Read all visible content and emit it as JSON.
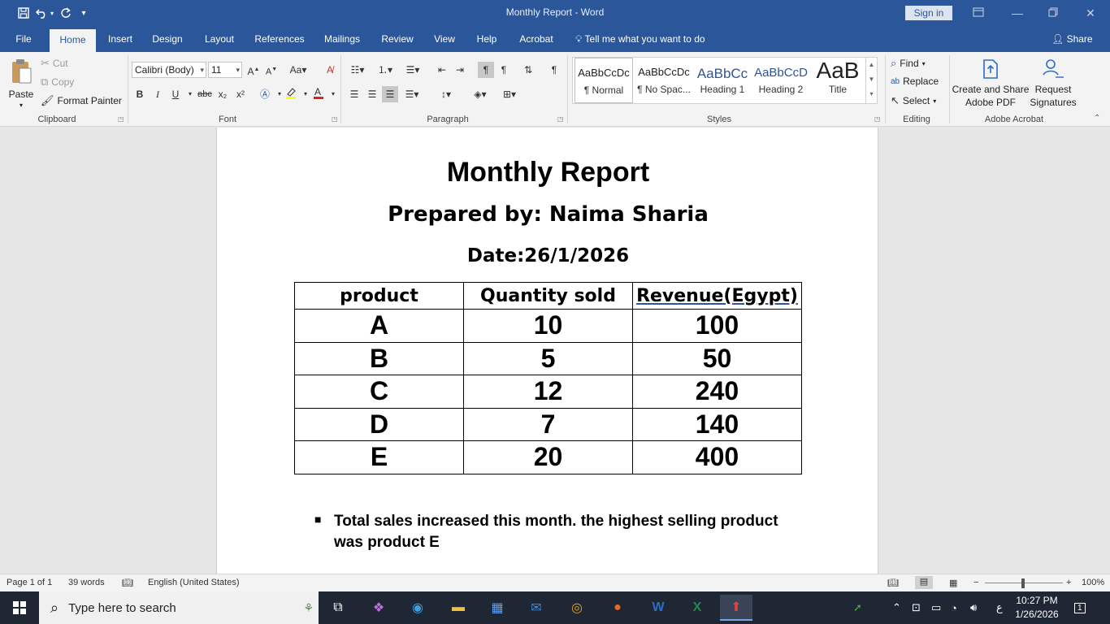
{
  "window": {
    "title": "Monthly Report  -  Word",
    "sign_in": "Sign in"
  },
  "tabs": [
    "File",
    "Home",
    "Insert",
    "Design",
    "Layout",
    "References",
    "Mailings",
    "Review",
    "View",
    "Help",
    "Acrobat"
  ],
  "tell_me": "Tell me what you want to do",
  "share": "Share",
  "clipboard": {
    "paste": "Paste",
    "cut": "Cut",
    "copy": "Copy",
    "format_painter": "Format Painter",
    "label": "Clipboard"
  },
  "font": {
    "name": "Calibri (Body)",
    "size": "11",
    "label": "Font",
    "bold": "B",
    "italic": "I",
    "underline": "U",
    "strike": "abc",
    "subscript": "x₂",
    "superscript": "x²"
  },
  "paragraph": {
    "label": "Paragraph"
  },
  "styles": {
    "label": "Styles",
    "items": [
      {
        "preview": "AaBbCcDc",
        "name": "¶ Normal"
      },
      {
        "preview": "AaBbCcDc",
        "name": "¶ No Spac..."
      },
      {
        "preview": "AaBbCc",
        "name": "Heading 1"
      },
      {
        "preview": "AaBbCcD",
        "name": "Heading 2"
      },
      {
        "preview": "AaB",
        "name": "Title"
      }
    ]
  },
  "editing": {
    "label": "Editing",
    "find": "Find",
    "replace": "Replace",
    "select": "Select"
  },
  "acrobat": {
    "label": "Adobe Acrobat",
    "create_line1": "Create and Share",
    "create_line2": "Adobe PDF",
    "request_line1": "Request",
    "request_line2": "Signatures"
  },
  "document": {
    "title": "Monthly Report",
    "prepared_by": "Prepared by: Naima Sharia",
    "date": "Date:26/1/2026",
    "table": {
      "headers": [
        "product",
        "Quantity sold",
        "Revenue(Egypt)"
      ],
      "rows": [
        [
          "A",
          "10",
          "100"
        ],
        [
          "B",
          "5",
          "50"
        ],
        [
          "C",
          "12",
          "240"
        ],
        [
          "D",
          "7",
          "140"
        ],
        [
          "E",
          "20",
          "400"
        ]
      ]
    },
    "bullet": "Total sales increased this month. the highest selling product was product E"
  },
  "status": {
    "page": "Page 1 of 1",
    "words": "39 words",
    "language": "English (United States)",
    "zoom": "100%"
  },
  "taskbar": {
    "search_placeholder": "Type here to search",
    "time": "10:27 PM",
    "date": "1/26/2026",
    "lang": "ع",
    "notifications": "1"
  },
  "colors": {
    "word_blue": "#2b579a",
    "ribbon_bg": "#f3f3f3",
    "taskbar_bg": "#1f2735"
  }
}
